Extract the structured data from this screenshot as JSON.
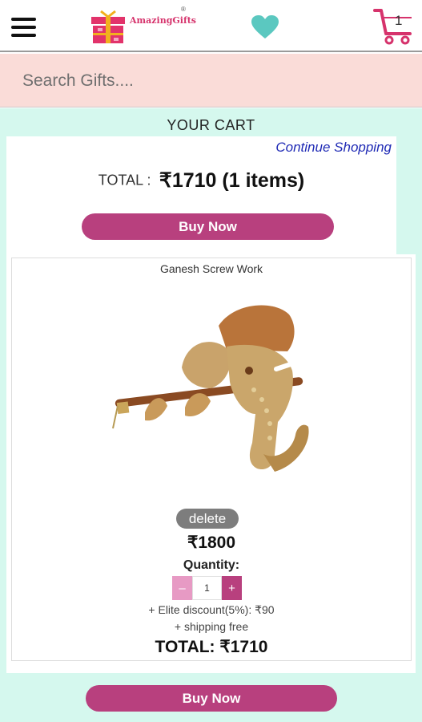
{
  "header": {
    "logo_text": "AmazingGifts",
    "cart_count": "1",
    "icons": {
      "menu": "hamburger-icon",
      "wishlist": "heart-icon",
      "cart": "cart-icon"
    },
    "colors": {
      "heart": "#5bc8c0",
      "cart": "#d6336c",
      "logo_box": "#e2336b",
      "logo_ribbon": "#f2b01e"
    }
  },
  "search": {
    "placeholder": "Search Gifts...."
  },
  "cart": {
    "heading": "YOUR CART",
    "continue_label": "Continue Shopping",
    "total_label": "TOTAL :",
    "total_value": "₹1710 (1 items)",
    "buy_now_label": "Buy Now"
  },
  "item": {
    "name": "Ganesh Screw Work",
    "delete_label": "delete",
    "price": "₹1800",
    "quantity_label": "Quantity:",
    "quantity_value": "1",
    "minus_label": "–",
    "plus_label": "+",
    "discount_text": "+ Elite discount(5%): ₹90",
    "shipping_text": "+ shipping free",
    "total_text": "TOTAL: ₹1710"
  },
  "footer": {
    "buy_now_label": "Buy Now"
  },
  "colors": {
    "accent": "#b8407e",
    "search_bg": "#fadcd8",
    "page_bg": "#d5f8ee",
    "link": "#1f2ab5"
  }
}
